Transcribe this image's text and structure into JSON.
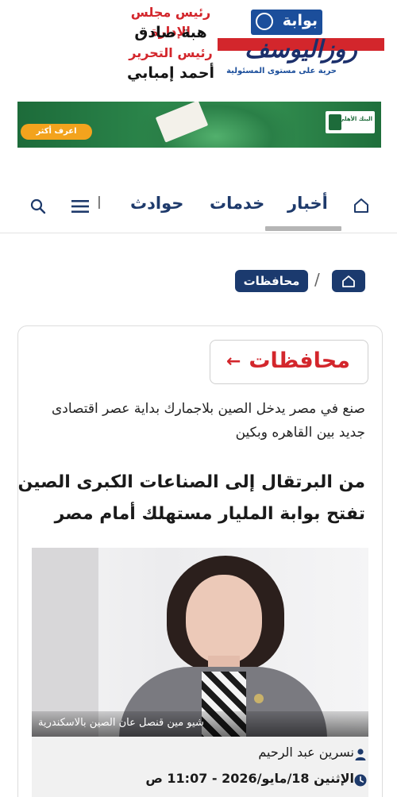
{
  "masthead": {
    "board_chair_title": "رئيس مجلس الإدارة",
    "board_chair_name": "هبة صادق",
    "editor_title": "رئيس التحرير",
    "editor_name": "أحمد إمبابي"
  },
  "logo": {
    "badge": "بوابة",
    "wordmark": "روزاليوسف",
    "tagline": "حرية على مستوى المسئولية"
  },
  "banner": {
    "button_label": "اعرف أكثر",
    "bank_name": "البنك الأهلي",
    "colors": {
      "primary": "#1d6b3a",
      "button": "#f3a31d"
    }
  },
  "nav": {
    "items": [
      {
        "label": "أخبار",
        "active": true
      },
      {
        "label": "خدمات"
      },
      {
        "label": "حوادث"
      }
    ],
    "separator": "ا",
    "icons": [
      "home-icon",
      "menu-icon",
      "search-icon"
    ]
  },
  "breadcrumb": {
    "separator": "/",
    "current": "محافظات"
  },
  "article": {
    "section": "محافظات",
    "section_arrow": "←",
    "subhead": "صنع في مصر يدخل الصين بلاجمارك بداية عصر اقتصادى جديد بين القاهره وبكين",
    "headline": "من البرتقال إلى الصناعات الكبرى الصين تفتح بوابة المليار مستهلك أمام مصر",
    "photo_caption": "شيو مين قنصل عان الصين بالاسكندرية",
    "author": "نسرين عبد الرحيم",
    "date": "الإثنين 18/مايو/2026 - 11:07 ص"
  },
  "colors": {
    "accent_red": "#d3262c",
    "nav_blue": "#1e3a6b",
    "chip_blue": "#1b3a6e"
  }
}
